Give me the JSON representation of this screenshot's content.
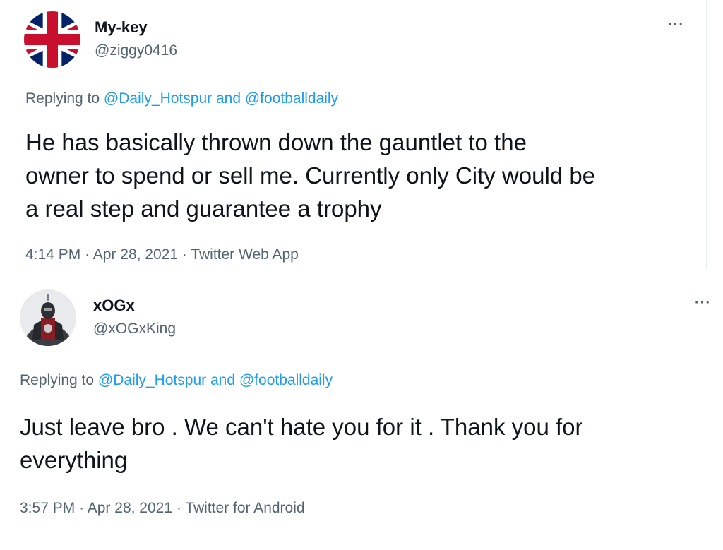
{
  "tweets": [
    {
      "display_name": "My-key",
      "handle": "@ziggy0416",
      "more_label": "···",
      "replying_prefix": "Replying to",
      "mention_1": "@Daily_Hotspur",
      "replying_and": "and",
      "mention_2": "@footballdaily",
      "text_line_1": "He has basically thrown down the gauntlet to the",
      "text_line_2": "owner to spend or sell me. Currently only City would be",
      "text_line_3": "a real step and guarantee a trophy",
      "time": "4:14 PM",
      "date": "Apr 28, 2021",
      "source": "Twitter Web App",
      "avatar_icon": "union-jack-flag-icon"
    },
    {
      "display_name": "xOGx",
      "handle": "@xOGxKing",
      "more_label": "···",
      "replying_prefix": "Replying to",
      "mention_1": "@Daily_Hotspur",
      "replying_and": "and",
      "mention_2": "@footballdaily",
      "text_line_1": "Just leave bro . We can't hate you for it . Thank you for",
      "text_line_2": "everything",
      "time": "3:57 PM",
      "date": "Apr 28, 2021",
      "source": "Twitter for Android",
      "avatar_icon": "superhero-avatar-icon"
    }
  ],
  "meta_separator": "·",
  "colors": {
    "mention": "#1d9bf0",
    "secondary_text": "#536471",
    "primary_text": "#0f1419"
  }
}
